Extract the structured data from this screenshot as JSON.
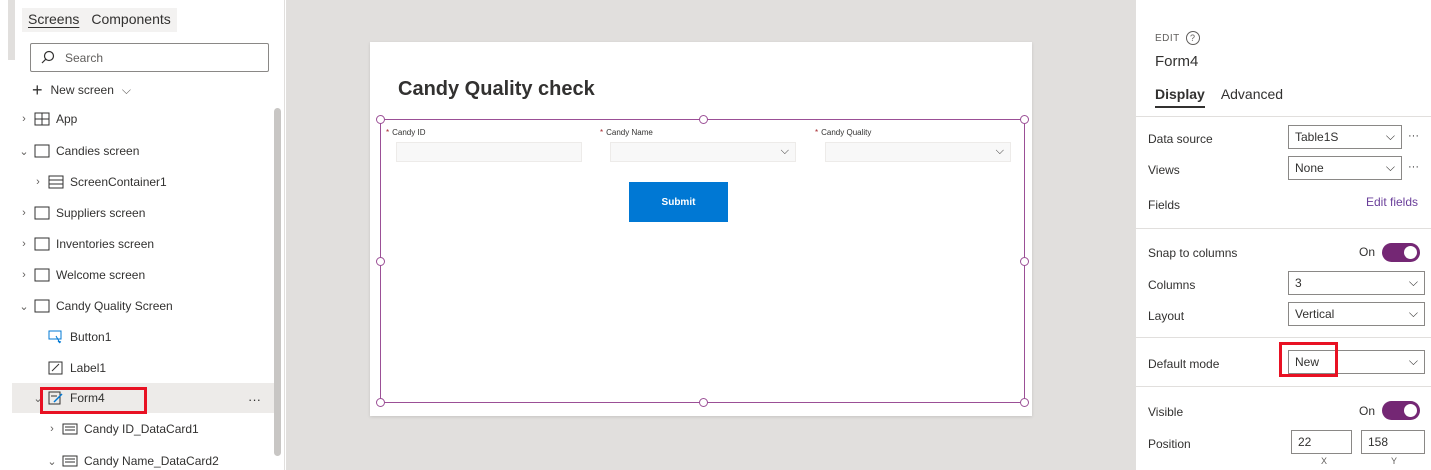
{
  "left": {
    "tabs": [
      "Screens",
      "Components"
    ],
    "search_placeholder": "Search",
    "new_screen": "New screen",
    "tree": [
      {
        "label": "App",
        "indent": 0,
        "chev": "›",
        "icon": "app-icon"
      },
      {
        "label": "Candies screen",
        "indent": 0,
        "chev": "⌄",
        "icon": "screen-icon"
      },
      {
        "label": "ScreenContainer1",
        "indent": 1,
        "chev": "›",
        "icon": "container-icon"
      },
      {
        "label": "Suppliers screen",
        "indent": 0,
        "chev": "›",
        "icon": "screen-icon"
      },
      {
        "label": "Inventories screen",
        "indent": 0,
        "chev": "›",
        "icon": "screen-icon"
      },
      {
        "label": "Welcome screen",
        "indent": 0,
        "chev": "›",
        "icon": "screen-icon"
      },
      {
        "label": "Candy Quality Screen",
        "indent": 0,
        "chev": "⌄",
        "icon": "screen-icon"
      },
      {
        "label": "Button1",
        "indent": 1,
        "chev": "",
        "icon": "button-icon"
      },
      {
        "label": "Label1",
        "indent": 1,
        "chev": "",
        "icon": "label-icon"
      },
      {
        "label": "Form4",
        "indent": 1,
        "chev": "⌄",
        "icon": "form-icon"
      },
      {
        "label": "Candy ID_DataCard1",
        "indent": 2,
        "chev": "›",
        "icon": "card-icon"
      },
      {
        "label": "Candy Name_DataCard2",
        "indent": 2,
        "chev": "⌄",
        "icon": "card-icon"
      }
    ],
    "more": "···"
  },
  "canvas": {
    "title": "Candy Quality check",
    "fields": [
      {
        "label": "Candy ID",
        "type": "text"
      },
      {
        "label": "Candy Name",
        "type": "dropdown"
      },
      {
        "label": "Candy Quality",
        "type": "dropdown"
      }
    ],
    "submit": "Submit"
  },
  "right": {
    "edit": "EDIT",
    "help": "?",
    "name": "Form4",
    "tabs": [
      "Display",
      "Advanced"
    ],
    "data_source_label": "Data source",
    "data_source_value": "Table1S",
    "views_label": "Views",
    "views_value": "None",
    "fields_label": "Fields",
    "edit_fields": "Edit fields",
    "snap_label": "Snap to columns",
    "snap_value": "On",
    "columns_label": "Columns",
    "columns_value": "3",
    "layout_label": "Layout",
    "layout_value": "Vertical",
    "default_mode_label": "Default mode",
    "default_mode_value": "New",
    "visible_label": "Visible",
    "visible_value": "On",
    "position_label": "Position",
    "position_x": "22",
    "position_y": "158",
    "x_label": "X",
    "y_label": "Y",
    "ellipsis": "···"
  },
  "colors": {
    "accent": "#742774",
    "primary": "#0078d4",
    "highlight": "#e81123"
  }
}
